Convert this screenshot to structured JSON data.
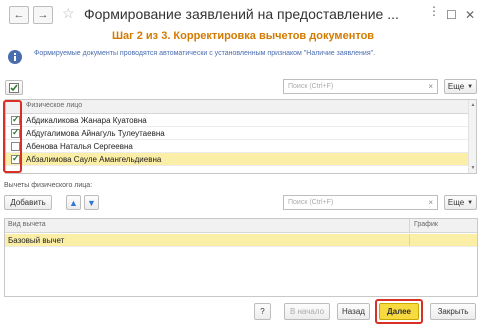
{
  "window": {
    "back_icon": "arrow-left",
    "forward_icon": "arrow-right",
    "star_icon": "star",
    "title": "Формирование заявлений на предоставление ...",
    "more_icon": "more-vertical",
    "maximize_icon": "maximize",
    "close_icon": "close"
  },
  "step_title": "Шаг 2 из 3. Корректировка вычетов документов",
  "info_text": "Формируемые документы проводятся автоматически с установленным признаком \"Наличие заявления\".",
  "top_table": {
    "search_placeholder": "Поиск (Ctrl+F)",
    "more_label": "Еще",
    "column_header": "Физическое лицо",
    "rows": [
      {
        "name": "Абдикаликова Жанара Куатовна",
        "checked": true
      },
      {
        "name": "Абдугалимова Айнагуль Тулеутаевна",
        "checked": true
      },
      {
        "name": "Абенова Наталья Сергеевна",
        "checked": false
      },
      {
        "name": "Абзалимова Сауле Амангельдиевна",
        "checked": true
      }
    ]
  },
  "bottom_section": {
    "label": "Вычеты физического лица:",
    "add_label": "Добавить",
    "search_placeholder": "Поиск (Ctrl+F)",
    "more_label": "Еще",
    "col_deduction": "Вид вычета",
    "col_schedule": "График",
    "rows": [
      {
        "deduction": "Базовый вычет",
        "schedule": ""
      }
    ]
  },
  "footer": {
    "help_label": "?",
    "start_label": "В начало",
    "back_label": "Назад",
    "next_label": "Далее",
    "close_label": "Закрыть"
  },
  "colors": {
    "accent": "#d37b00",
    "selection": "#fbeea6",
    "primary_button": "#f7d940",
    "highlight_frame": "#d93025"
  }
}
